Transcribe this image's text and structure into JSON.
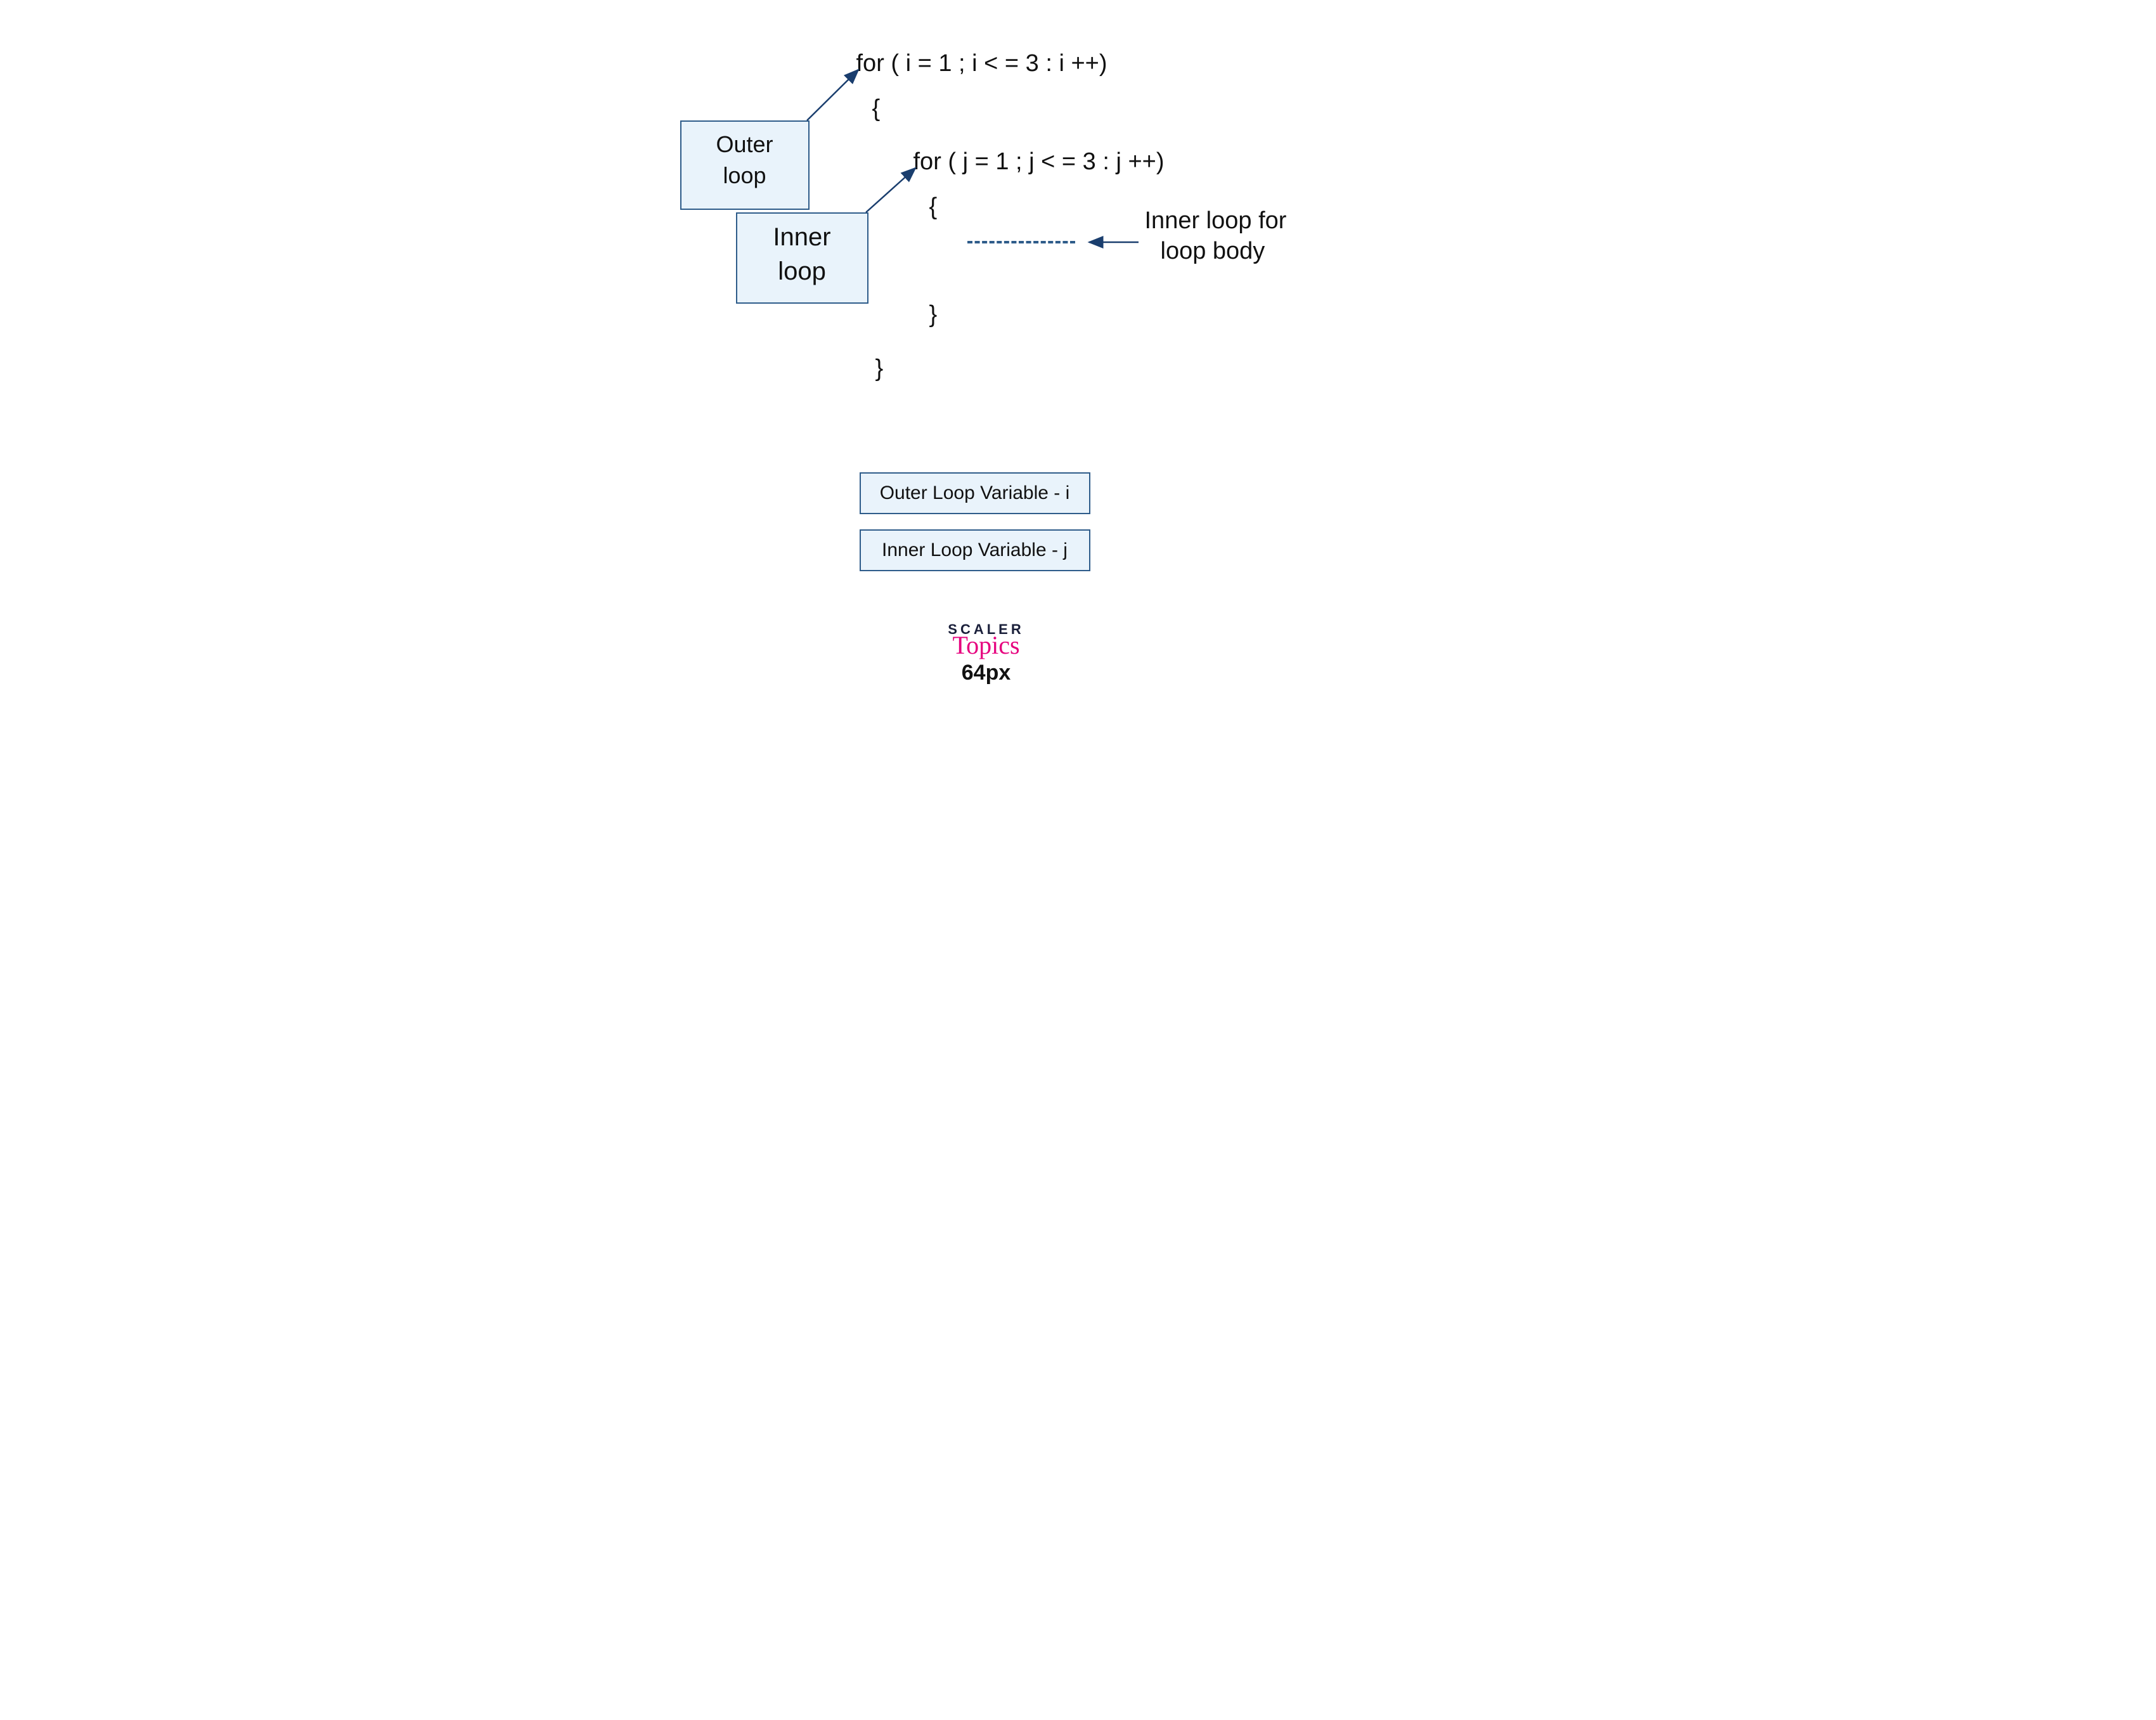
{
  "code": {
    "outer_for": "for ( i = 1 ; i < = 3 : i ++)",
    "outer_open": "{",
    "inner_for": "for ( j = 1 ; j < = 3 : j ++)",
    "inner_open": "{",
    "inner_close": "}",
    "outer_close": "}"
  },
  "labels": {
    "outer_line1": "Outer",
    "outer_line2": "loop",
    "inner_line1": "Inner",
    "inner_line2": "loop",
    "body_line1": "Inner loop for",
    "body_line2": "loop body"
  },
  "legend": {
    "outer_var": "Outer Loop Variable - i",
    "inner_var": "Inner Loop Variable - j"
  },
  "logo": {
    "brand": "SCALER",
    "sub": "Topics",
    "px": "64px"
  }
}
